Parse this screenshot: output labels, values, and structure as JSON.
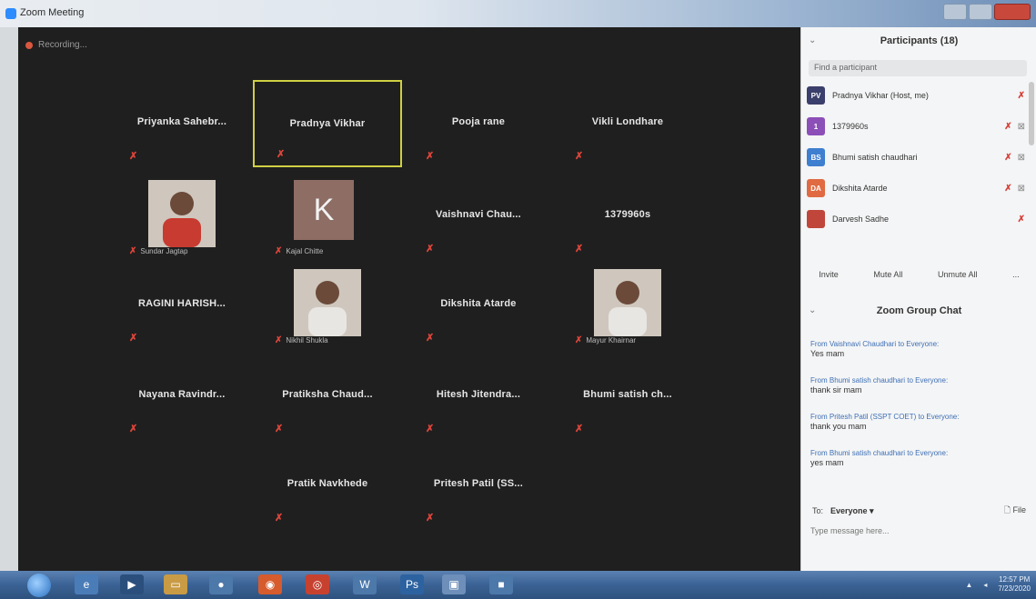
{
  "window": {
    "title": "Zoom Meeting"
  },
  "recording": {
    "label": "Recording..."
  },
  "grid": [
    {
      "name": "Priyanka Sahebr...",
      "kind": "name"
    },
    {
      "name": "Pradnya Vikhar",
      "kind": "name",
      "active": true
    },
    {
      "name": "Pooja rane",
      "kind": "name"
    },
    {
      "name": "Vikli Londhare",
      "kind": "name"
    },
    {
      "name": "Sundar Jagtap",
      "kind": "photo"
    },
    {
      "name": "Kajal Chitte",
      "kind": "avatar",
      "initial": "K"
    },
    {
      "name": "Vaishnavi Chau...",
      "kind": "name"
    },
    {
      "name": "1379960s",
      "kind": "name"
    },
    {
      "name": "RAGINI HARISH...",
      "kind": "name"
    },
    {
      "name": "Nikhil Shukla",
      "kind": "photo"
    },
    {
      "name": "Dikshita Atarde",
      "kind": "name"
    },
    {
      "name": "Mayur Khairnar",
      "kind": "photo"
    },
    {
      "name": "Nayana Ravindr...",
      "kind": "name"
    },
    {
      "name": "Pratiksha Chaud...",
      "kind": "name"
    },
    {
      "name": "Hitesh Jitendra...",
      "kind": "name"
    },
    {
      "name": "Bhumi satish ch...",
      "kind": "name"
    },
    {
      "name": "Pratik Navkhede",
      "kind": "name"
    },
    {
      "name": "Pritesh Patil (SS...",
      "kind": "name"
    }
  ],
  "mic_symbol": "✗",
  "participants": {
    "title": "Participants (18)",
    "find_placeholder": "Find a participant",
    "list": [
      {
        "initials": "PV",
        "name": "Pradnya Vikhar (Host, me)",
        "color": "#3b3f6b"
      },
      {
        "initials": "1",
        "name": "1379960s",
        "color": "#8c4fb8"
      },
      {
        "initials": "BS",
        "name": "Bhumi satish chaudhari",
        "color": "#3f7fd0"
      },
      {
        "initials": "DA",
        "name": "Dikshita Atarde",
        "color": "#e06a42"
      },
      {
        "initials": "",
        "name": "Darvesh Sadhe",
        "color": "#c0463b"
      }
    ],
    "buttons": {
      "invite": "Invite",
      "mute_all": "Mute All",
      "unmute_all": "Unmute All",
      "more": "..."
    }
  },
  "chat": {
    "title": "Zoom Group Chat",
    "messages": [
      {
        "from": "From Vaishnavi Chaudhari to Everyone:",
        "text": "Yes mam"
      },
      {
        "from": "From Bhumi satish chaudhari to Everyone:",
        "text": "thank sir mam"
      },
      {
        "from": "From Pritesh Patil (SSPT COET) to Everyone:",
        "text": "thank you mam"
      },
      {
        "from": "From Bhumi satish chaudhari to Everyone:",
        "text": "yes mam"
      }
    ],
    "to_label": "To:",
    "to_value": "Everyone ▾",
    "file_label": "File",
    "input_placeholder": "Type message here..."
  },
  "taskbar": {
    "time": "12:57 PM",
    "date": "7/23/2020"
  }
}
